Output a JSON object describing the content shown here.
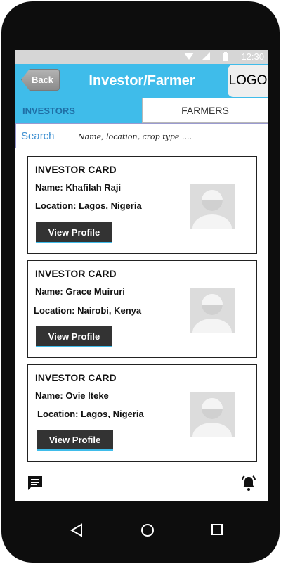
{
  "statusbar": {
    "time": "12:30",
    "icons": [
      "wifi-icon",
      "signal-icon",
      "battery-icon"
    ]
  },
  "appbar": {
    "back_label": "Back",
    "title": "Investor/Farmer",
    "logo_label": "LOGO"
  },
  "tabs": [
    {
      "label": "INVESTORS",
      "active": true
    },
    {
      "label": "FARMERS",
      "active": false
    }
  ],
  "search": {
    "label": "Search",
    "placeholder": "Name, location, crop type ...."
  },
  "cards": [
    {
      "title": "INVESTOR CARD",
      "name": "Name: Khafilah Raji",
      "location": "Location: Lagos, Nigeria",
      "button_label": "View Profile"
    },
    {
      "title": "INVESTOR CARD",
      "name": "Name: Grace Muiruri",
      "location": "Location: Nairobi, Kenya",
      "button_label": "View Profile"
    },
    {
      "title": "INVESTOR CARD",
      "name": "Name: Ovie Iteke",
      "location": "Location: Lagos, Nigeria",
      "button_label": "View Profile"
    }
  ],
  "bottom_icons": [
    "chat-icon",
    "bell-icon"
  ],
  "nav_icons": [
    "back-triangle-icon",
    "home-circle-icon",
    "recent-square-icon"
  ],
  "colors": {
    "accent": "#3fbcea",
    "button_dark": "#333333",
    "frame": "#0d0d0d"
  }
}
